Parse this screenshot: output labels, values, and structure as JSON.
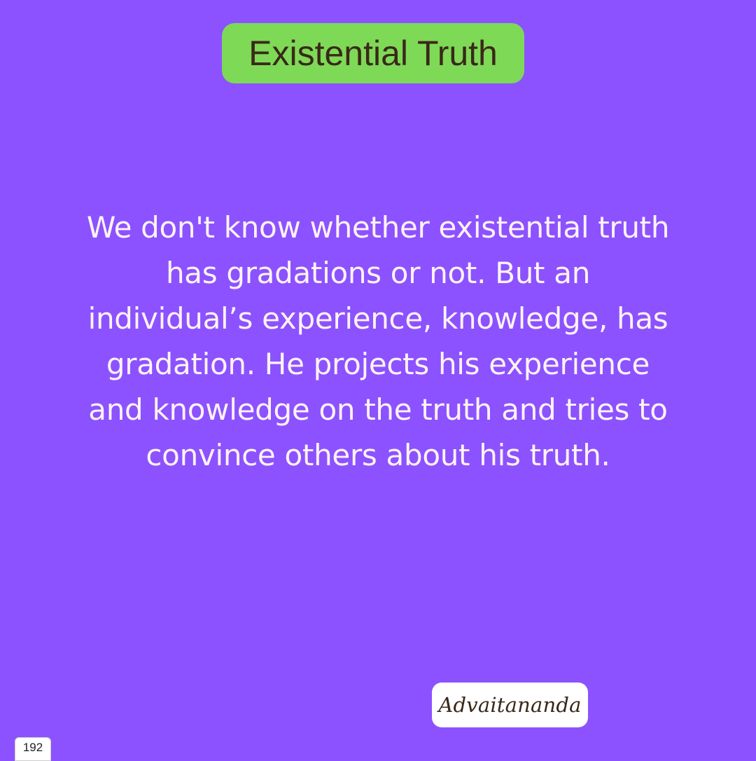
{
  "title": "Existential Truth",
  "quote": "We don't know whether existential truth has gradations or not. But an individual’s experience, knowledge, has gradation. He projects his experience and knowledge on the truth and tries to convince others about his truth.",
  "author": "Advaitananda",
  "page_number": "192",
  "colors": {
    "background": "#8c52ff",
    "title_badge": "#7ed957",
    "title_text": "#3a2818",
    "quote_text": "#fff3f3",
    "signature_badge": "#ffffff",
    "signature_text": "#3a2818"
  }
}
